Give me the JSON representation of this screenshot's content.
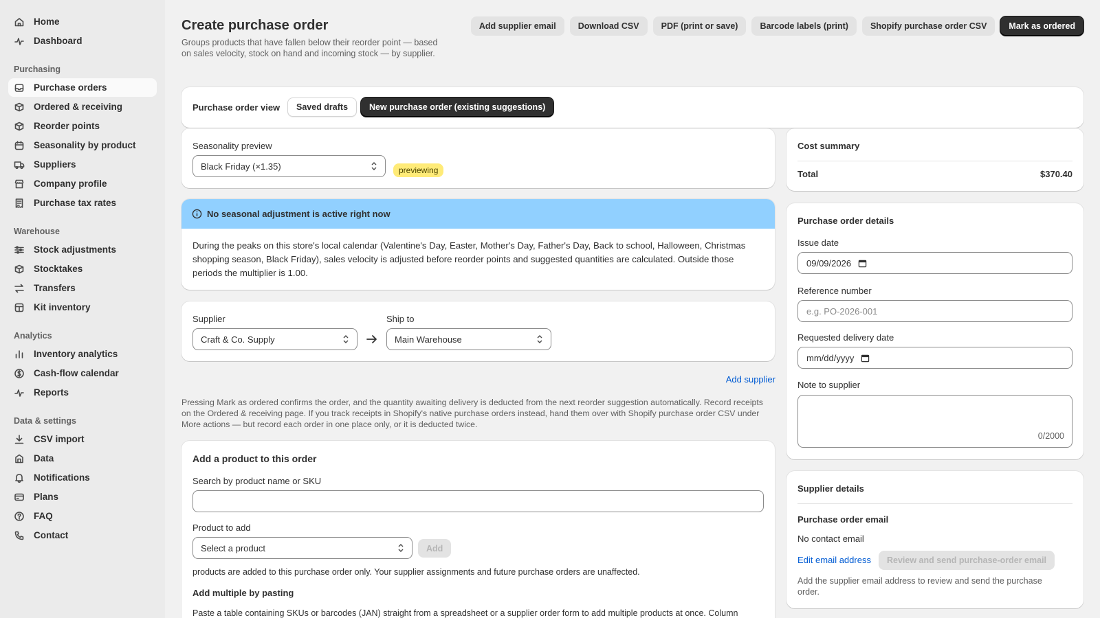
{
  "sidebar": {
    "top_items": [
      {
        "label": "Home",
        "icon": "home-icon"
      },
      {
        "label": "Dashboard",
        "icon": "pulse-icon"
      }
    ],
    "sections": [
      {
        "title": "Purchasing",
        "items": [
          {
            "label": "Purchase orders",
            "icon": "inbox-icon",
            "active": true
          },
          {
            "label": "Ordered & receiving",
            "icon": "box-icon"
          },
          {
            "label": "Reorder points",
            "icon": "box-icon"
          },
          {
            "label": "Seasonality by product",
            "icon": "calendar-icon"
          },
          {
            "label": "Suppliers",
            "icon": "truck-icon"
          },
          {
            "label": "Company profile",
            "icon": "store-icon"
          },
          {
            "label": "Purchase tax rates",
            "icon": "receipt-icon"
          }
        ]
      },
      {
        "title": "Warehouse",
        "items": [
          {
            "label": "Stock adjustments",
            "icon": "sliders-icon"
          },
          {
            "label": "Stocktakes",
            "icon": "box-icon"
          },
          {
            "label": "Transfers",
            "icon": "transfer-icon"
          },
          {
            "label": "Kit inventory",
            "icon": "kit-icon"
          }
        ]
      },
      {
        "title": "Analytics",
        "items": [
          {
            "label": "Inventory analytics",
            "icon": "bar-chart-icon"
          },
          {
            "label": "Cash-flow calendar",
            "icon": "cash-icon"
          },
          {
            "label": "Reports",
            "icon": "pulse-icon"
          }
        ]
      },
      {
        "title": "Data & settings",
        "items": [
          {
            "label": "CSV import",
            "icon": "download-icon"
          },
          {
            "label": "Data",
            "icon": "database-icon"
          },
          {
            "label": "Notifications",
            "icon": "bell-icon"
          },
          {
            "label": "Plans",
            "icon": "card-icon"
          },
          {
            "label": "FAQ",
            "icon": "question-icon"
          },
          {
            "label": "Contact",
            "icon": "phone-icon"
          }
        ]
      }
    ]
  },
  "header": {
    "title": "Create purchase order",
    "subtitle": "Groups products that have fallen below their reorder point — based on sales velocity, stock on hand and incoming stock — by supplier.",
    "actions": {
      "add_supplier_email": "Add supplier email",
      "download_csv": "Download CSV",
      "pdf": "PDF (print or save)",
      "barcode": "Barcode labels (print)",
      "shopify_csv": "Shopify purchase order CSV",
      "mark_ordered": "Mark as ordered"
    }
  },
  "view": {
    "label": "Purchase order view",
    "saved_drafts": "Saved drafts",
    "new_po": "New purchase order (existing suggestions)"
  },
  "seasonality": {
    "label": "Seasonality preview",
    "selected": "Black Friday (×1.35)",
    "badge": "previewing"
  },
  "banner": {
    "title": "No seasonal adjustment is active right now",
    "body": "During the peaks on this store's local calendar (Valentine's Day, Easter, Mother's Day, Father's Day, Back to school, Halloween, Christmas shopping season, Black Friday), sales velocity is adjusted before reorder points and suggested quantities are calculated. Outside those periods the multiplier is 1.00."
  },
  "route": {
    "supplier_label": "Supplier",
    "supplier_value": "Craft & Co. Supply",
    "ship_label": "Ship to",
    "ship_value": "Main Warehouse",
    "add_supplier": "Add supplier"
  },
  "notice": "Pressing Mark as ordered confirms the order, and the quantity awaiting delivery is deducted from the next reorder suggestion automatically. Record receipts on the Ordered & receiving page. If you track receipts in Shopify's native purchase orders instead, hand them over with Shopify purchase order CSV under More actions — but record each order in one place only, or it is deducted twice.",
  "add_product": {
    "title": "Add a product to this order",
    "search_label": "Search by product name or SKU",
    "search_value": "",
    "product_label": "Product to add",
    "product_select": "Select a product",
    "add_button": "Add",
    "helper": "products are added to this purchase order only. Your supplier assignments and future purchase orders are unaffected.",
    "multi_title": "Add multiple by pasting",
    "multi_body": "Paste a table containing SKUs or barcodes (JAN) straight from a spreadsheet or a supplier order form to add multiple products at once. Column"
  },
  "cost_summary": {
    "title": "Cost summary",
    "total_label": "Total",
    "total_value": "$370.40"
  },
  "po_details": {
    "title": "Purchase order details",
    "issue_label": "Issue date",
    "issue_value": "09/09/2026",
    "ref_label": "Reference number",
    "ref_placeholder": "e.g. PO-2026-001",
    "delivery_label": "Requested delivery date",
    "delivery_value": "mm/dd/yyyy",
    "note_label": "Note to supplier",
    "note_count": "0/2000"
  },
  "supplier_details": {
    "title": "Supplier details",
    "email_heading": "Purchase order email",
    "email_value": "No contact email",
    "edit_link": "Edit email address",
    "send_button": "Review and send purchase-order email",
    "helper": "Add the supplier email address to review and send the purchase order."
  },
  "colors": {
    "banner": "#91d0ff",
    "badge": "#ffeb78",
    "link": "#005bd3",
    "primary": "#303030"
  }
}
